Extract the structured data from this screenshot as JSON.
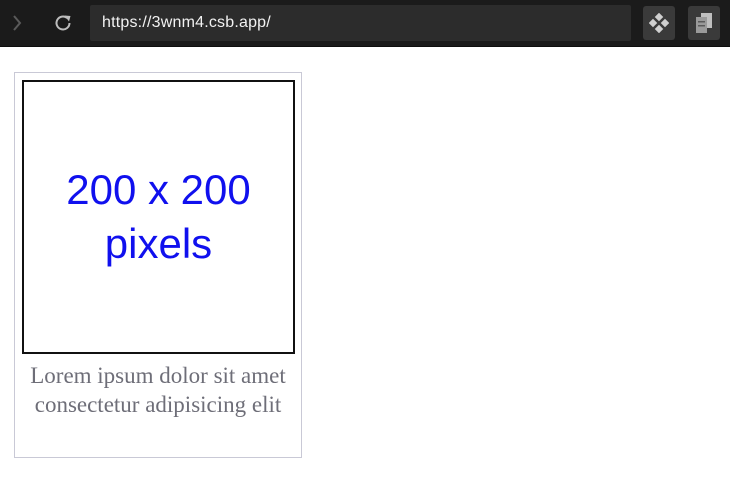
{
  "browser": {
    "url": "https://3wnm4.csb.app/",
    "icons": {
      "forward": "chevron-right-icon",
      "reload": "reload-icon",
      "extension_1": "puzzle-icon",
      "extension_2": "copy-icon"
    }
  },
  "page": {
    "image_placeholder": {
      "line1": "200 x 200",
      "line2": "pixels",
      "color": "#1010ee"
    },
    "caption": "Lorem ipsum dolor sit amet consectetur adipisicing elit"
  }
}
